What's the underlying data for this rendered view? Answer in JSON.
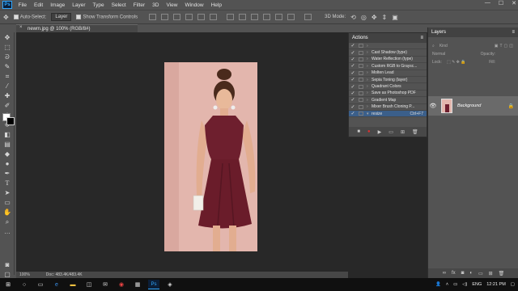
{
  "menubar": {
    "logo": "Ps",
    "items": [
      "File",
      "Edit",
      "Image",
      "Layer",
      "Type",
      "Select",
      "Filter",
      "3D",
      "View",
      "Window",
      "Help"
    ]
  },
  "window_controls": {
    "minimize": "—",
    "maximize": "☐",
    "close": "✕"
  },
  "options_bar": {
    "auto_select_label": "Auto-Select:",
    "auto_select_value": "Layer",
    "show_transform_label": "Show Transform Controls"
  },
  "document": {
    "tab_title": "newm.jpg @ 100% (RGB/8#)",
    "close": "×"
  },
  "status_bar": {
    "zoom": "100%",
    "doc_size": "Doc: 483.4K/483.4K"
  },
  "actions_panel": {
    "title": "Actions",
    "rows": [
      {
        "name": "",
        "checked": true
      },
      {
        "name": "Cast Shadow (type)",
        "checked": true
      },
      {
        "name": "Water Reflection (type)",
        "checked": true
      },
      {
        "name": "Custom RGB to Graysc...",
        "checked": true
      },
      {
        "name": "Molten Lead",
        "checked": true
      },
      {
        "name": "Sepia Toning (layer)",
        "checked": true
      },
      {
        "name": "Quadrant Colors",
        "checked": true
      },
      {
        "name": "Save as Photoshop PDF",
        "checked": true
      },
      {
        "name": "Gradient Map",
        "checked": true
      },
      {
        "name": "Mixer Brush Cloning P...",
        "checked": true
      },
      {
        "name": "resize",
        "shortcut": "Ctrl+F7",
        "checked": true,
        "selected": true
      }
    ],
    "footer_icons": [
      "stop-icon",
      "record-icon",
      "play-icon",
      "folder-icon",
      "new-action-icon",
      "trash-icon"
    ]
  },
  "layers_panel": {
    "tab": "Layers",
    "kind_label": "Kind",
    "blend_mode": "Normal",
    "opacity_label": "Opacity:",
    "lock_label": "Lock:",
    "fill_label": "Fill:",
    "background_layer_name": "Background"
  },
  "taskbar": {
    "language": "ENG",
    "time": "12:21 PM"
  },
  "colors": {
    "accent": "#3b5f8a",
    "photo_bg": "#e3b6ad",
    "dress": "#6e1f2e"
  }
}
